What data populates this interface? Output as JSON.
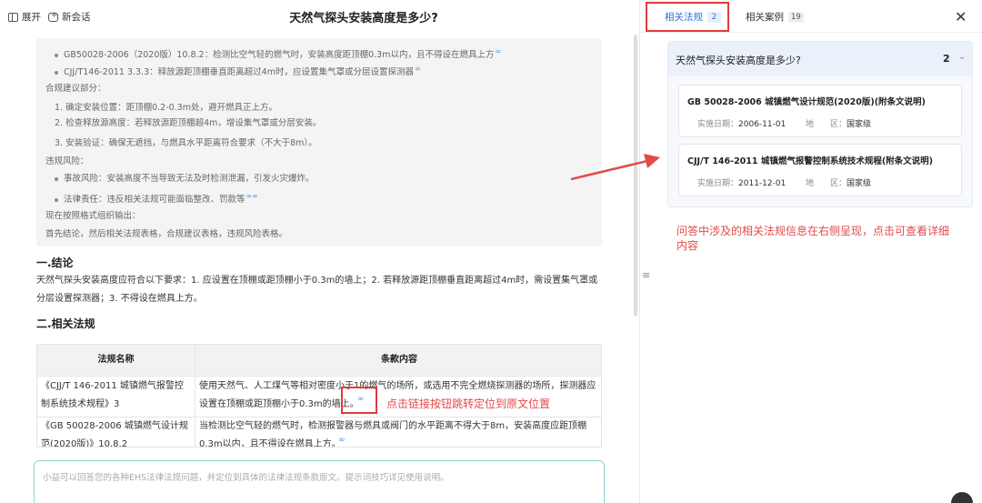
{
  "toolbar": {
    "expand_label": "展开",
    "new_chat_label": "新会话"
  },
  "page_title": "天然气探头安装高度是多少?",
  "reasoning": {
    "bullets_top": [
      "GB50028-2006（2020版）10.8.2：检测比空气轻的燃气时，安装高度距顶棚0.3m以内，且不得设在燃具上方",
      "CJJ/T146-2011 3.3.3：释放源距顶棚垂直距离超过4m时，应设置集气罩或分层设置探测器"
    ],
    "section1_label": "合规建议部分：",
    "section1_items": [
      "1. 确定安装位置：距顶棚0.2-0.3m处，避开燃具正上方。",
      "2. 检查释放源高度：若释放源距顶棚超4m，增设集气罩或分层安装。",
      "3. 安装验证：确保无遮挡，与燃具水平距离符合要求（不大于8m）。"
    ],
    "section2_label": "违规风险：",
    "section2_items": [
      "事故风险：安装高度不当导致无法及时检测泄漏，引发火灾爆炸。",
      "法律责任：违反相关法规可能面临整改、罚款等"
    ],
    "tail1": "现在按照格式组织输出：",
    "tail2": "首先结论，然后相关法规表格，合规建议表格，违规风险表格。"
  },
  "conclusion": {
    "heading": "一.结论",
    "text": "天然气探头安装高度应符合以下要求：1. 应设置在顶棚或距顶棚小于0.3m的墙上；2. 若释放源距顶棚垂直距离超过4m时，需设置集气罩或分层设置探测器；3. 不得设在燃具上方。"
  },
  "laws_section": {
    "heading": "二.相关法规",
    "columns": [
      "法规名称",
      "条款内容"
    ],
    "rows": [
      {
        "name": "《CJJ/T 146-2011 城镇燃气报警控制系统技术规程》3",
        "content": "使用天然气、人工煤气等相对密度小于1的燃气的场所，或选用不完全燃烧探测器的场所，探测器应设置在顶棚或距顶棚小于0.3m的墙上。"
      },
      {
        "name": "《GB 50028-2006 城镇燃气设计规范(2020版)》10.8.2",
        "content": "当检测比空气轻的燃气时，检测报警器与燃具或阀门的水平距离不得大于8m，安装高度应距顶棚0.3m以内，且不得设在燃具上方。"
      }
    ]
  },
  "annotation_left": "点击链接按钮跳转定位到原文位置",
  "input": {
    "placeholder": "小益可以回答您的各种EHS法律法规问题，并定位到具体的法律法规条款原文。提示词技巧详见使用说明。"
  },
  "right_panel": {
    "tabs": [
      {
        "label": "相关法规",
        "count": "2"
      },
      {
        "label": "相关案例",
        "count": "19"
      }
    ],
    "question": {
      "title": "天然气探头安装高度是多少?",
      "count": "2"
    },
    "laws": [
      {
        "title": "GB 50028-2006 城镇燃气设计规范(2020版)(附条文说明)",
        "date_label": "实施日期：",
        "date": "2006-11-01",
        "region_label": "地　　区：",
        "region": "国家级"
      },
      {
        "title": "CJJ/T 146-2011 城镇燃气报警控制系统技术规程(附条文说明)",
        "date_label": "实施日期：",
        "date": "2011-12-01",
        "region_label": "地　　区：",
        "region": "国家级"
      }
    ],
    "annotation": "问答中涉及的相关法规信息在右侧呈现，点击可查看详细内容"
  },
  "colors": {
    "accent": "#2f6fd6",
    "annotation_red": "#e34a4a"
  }
}
